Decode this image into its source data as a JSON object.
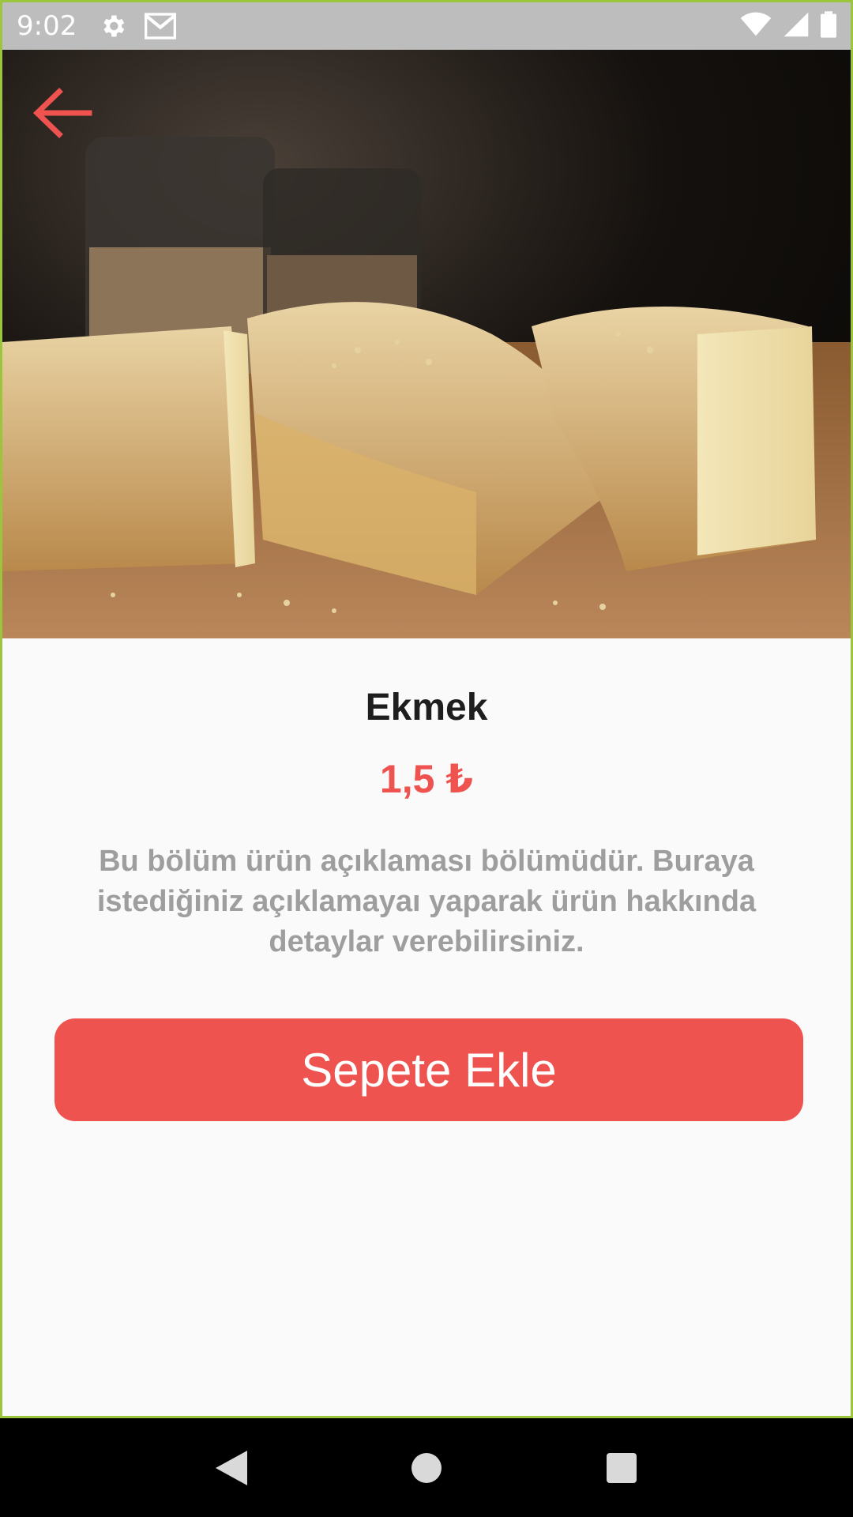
{
  "status_bar": {
    "time": "9:02",
    "icons": [
      "gear-icon",
      "mail-icon",
      "wifi-icon",
      "signal-icon",
      "battery-icon"
    ]
  },
  "hero": {
    "image_subject": "bread-photo",
    "back_icon": "arrow-left-icon"
  },
  "product": {
    "title": "Ekmek",
    "price": "1,5 ₺",
    "description": "Bu bölüm ürün açıklaması bölümüdür. Buraya istediğiniz açıklamayaı yaparak ürün hakkında detaylar verebilirsiniz."
  },
  "actions": {
    "add_to_cart_label": "Sepete Ekle"
  },
  "nav_bar": {
    "icons": [
      "back-triangle-icon",
      "home-circle-icon",
      "recents-square-icon"
    ]
  },
  "colors": {
    "accent": "#ef5350",
    "frame": "#9bc53d",
    "status_bar": "#bdbdbd"
  }
}
